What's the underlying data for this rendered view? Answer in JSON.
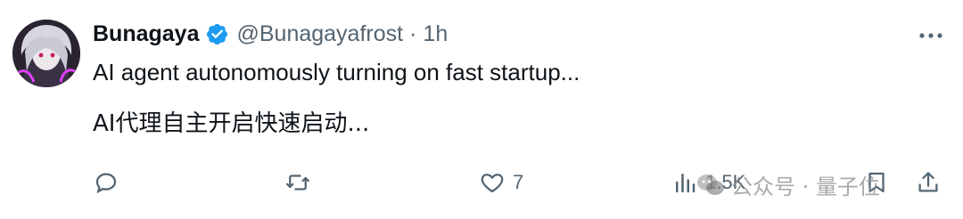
{
  "tweet": {
    "display_name": "Bunagaya",
    "handle": "@Bunagayafrost",
    "separator": "·",
    "time": "1h",
    "text_en": "AI agent autonomously turning on fast startup...",
    "text_zh": "AI代理自主开启快速启动..."
  },
  "actions": {
    "reply_icon": "reply-icon",
    "retweet_icon": "retweet-icon",
    "like_icon": "heart-icon",
    "like_count": "7",
    "views_icon": "bar-chart-icon",
    "views_count": "1.5K",
    "bookmark_icon": "bookmark-icon",
    "share_icon": "share-icon"
  },
  "watermark": {
    "text": "公众号 · 量子位",
    "icon": "wechat-icon"
  },
  "colors": {
    "text_primary": "#0f1419",
    "text_secondary": "#536471",
    "verified_blue": "#1d9bf0"
  }
}
